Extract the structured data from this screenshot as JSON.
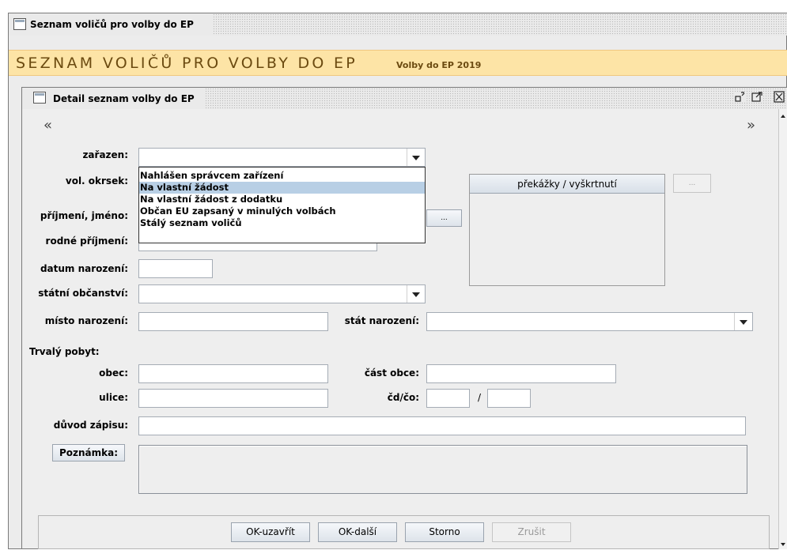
{
  "outer_window": {
    "title": "Seznam voličů pro volby do EP"
  },
  "banner": {
    "title": "SEZNAM VOLIČŮ PRO VOLBY DO EP",
    "subtitle": "Volby do EP 2019"
  },
  "inner_window": {
    "title": "Detail seznam volby do EP"
  },
  "nav": {
    "prev": "«",
    "next": "»"
  },
  "form": {
    "zarazen": {
      "label": "zařazen:",
      "value": ""
    },
    "dropdown_options": [
      "Nahlášen správcem zařízení",
      "Na vlastní žádost",
      "Na vlastní žádost z dodatku",
      "Občan EU zapsaný v minulých volbách",
      "Stálý seznam voličů"
    ],
    "dropdown_highlighted": "Na vlastní žádost",
    "vol_okrsek": {
      "label": "vol. okrsek:"
    },
    "prijmeni_jmeno": {
      "label": "příjmení, jméno:"
    },
    "rodne_prijmeni": {
      "label": "rodné příjmení:"
    },
    "datum_narozeni": {
      "label": "datum narození:",
      "value": ""
    },
    "statni_obcanstvi": {
      "label": "státní občanství:",
      "value": ""
    },
    "misto_narozeni": {
      "label": "místo narození:",
      "value": ""
    },
    "stat_narozeni": {
      "label": "stát narození:",
      "value": ""
    },
    "trvaly_pobyt": {
      "label": "Trvalý pobyt:"
    },
    "obec": {
      "label": "obec:",
      "value": ""
    },
    "cast_obce": {
      "label": "část obce:",
      "value": ""
    },
    "ulice": {
      "label": "ulice:",
      "value": ""
    },
    "cd_co": {
      "label": "čd/čo:",
      "cd": "",
      "separator": "/",
      "co": ""
    },
    "duvod_zapisu": {
      "label": "důvod zápisu:",
      "value": ""
    },
    "poznamka": {
      "button": "Poznámka:",
      "value": ""
    },
    "ellipsis": "..."
  },
  "prekazky": {
    "header": "překážky / vyškrtnutí",
    "button": "..."
  },
  "footer": {
    "ok_uzavrit": "OK-uzavřít",
    "ok_dalsi": "OK-další",
    "storno": "Storno",
    "zrusit": "Zrušit"
  },
  "colors": {
    "banner_bg": "#fde4a6",
    "banner_text": "#6b4a10",
    "selection": "#b8cfe5",
    "panel_bg": "#eeeeee"
  }
}
